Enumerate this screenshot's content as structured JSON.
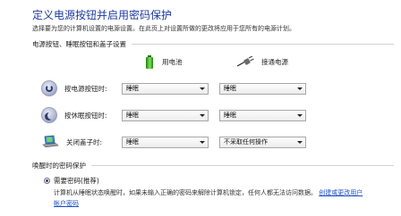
{
  "page": {
    "title": "定义电源按钮并启用密码保护",
    "description": "选择要为您的计算机设置的电源设置。在此页上对设置所做的更改将应用于您所有的电源计划。"
  },
  "buttons_section": {
    "header": "电源按钮、睡眠按钮和盖子设置",
    "col_battery": "用电池",
    "col_plugged": "接通电源",
    "rows": [
      {
        "label": "按电源按钮时:",
        "battery": "睡眠",
        "plugged": "睡眠"
      },
      {
        "label": "按休眠按钮时:",
        "battery": "睡眠",
        "plugged": "睡眠"
      },
      {
        "label": "关闭盖子时:",
        "battery": "睡眠",
        "plugged": "不采取任何操作"
      }
    ]
  },
  "password_section": {
    "header": "唤醒时的密码保护",
    "option_label": "需要密码(推荐)",
    "option_desc": "计算机从睡眠状态唤醒时，如果未输入正确的密码来解除计算机锁定，任何人都无法访问数据。",
    "link_text": "创建或更改用户帐户密码"
  },
  "colors": {
    "title": "#1c3a9e",
    "link": "#1a4fc7"
  }
}
